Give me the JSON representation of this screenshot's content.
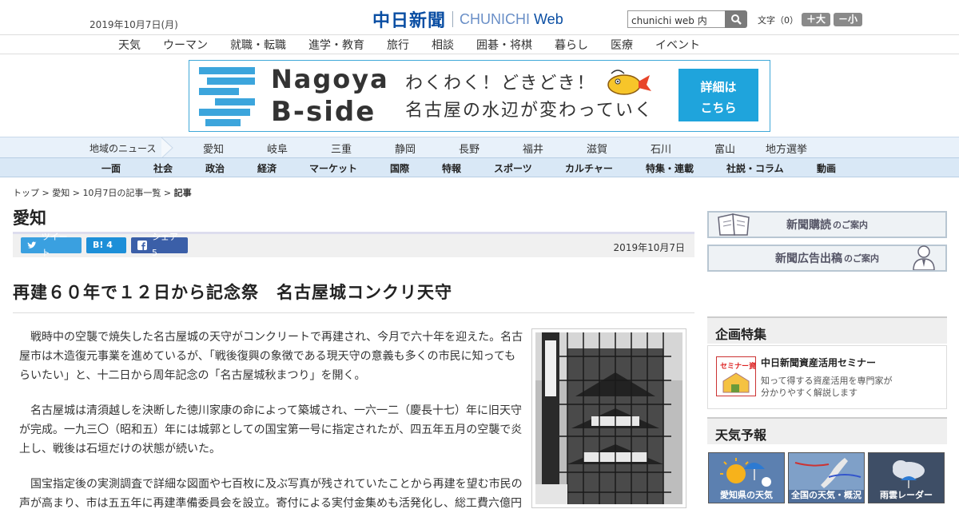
{
  "header": {
    "date": "2019年10月7日(月)",
    "logo_jp": "中日新聞",
    "logo_en_a": "CHUNICHI ",
    "logo_en_b": "Web",
    "search_value": "chunichi web 内",
    "font_label": "文字（0）",
    "font_large": "＋大",
    "font_small": "－小"
  },
  "catnav": [
    "天気",
    "ウーマン",
    "就職・転職",
    "進学・教育",
    "旅行",
    "相談",
    "囲碁・将棋",
    "暮らし",
    "医療",
    "イベント"
  ],
  "banner": {
    "name1": "Nagoya",
    "name2": "B-side",
    "copy1": "わくわく！どきどき！",
    "copy2": "名古屋の水辺が変わっていく",
    "button1": "詳細は",
    "button2": "こちら"
  },
  "region": {
    "label": "地域のニュース",
    "items": [
      "愛知",
      "岐阜",
      "三重",
      "静岡",
      "長野",
      "福井",
      "滋賀",
      "石川",
      "富山",
      "地方選挙"
    ]
  },
  "genre": [
    "一面",
    "社会",
    "政治",
    "経済",
    "マーケット",
    "国際",
    "特報",
    "スポーツ",
    "カルチャー",
    "特集・連載",
    "社説・コラム",
    "動画"
  ],
  "breadcrumb": {
    "items": [
      "トップ",
      "愛知",
      "10月7日の記事一覧"
    ],
    "sep": " > ",
    "current": "記事"
  },
  "page_title": "愛知",
  "share": {
    "tweet": "ツイート",
    "hatena": "B! 4",
    "facebook": "シェア 5",
    "date": "2019年10月7日"
  },
  "article": {
    "title": "再建６０年で１２日から記念祭　名古屋城コンクリ天守",
    "paragraphs": [
      "戦時中の空襲で焼失した名古屋城の天守がコンクリートで再建され、今月で六十年を迎えた。名古屋市は木造復元事業を進めているが、「戦後復興の象徴である現天守の意義も多くの市民に知ってもらいたい」と、十二日から周年記念の「名古屋城秋まつり」を開く。",
      "名古屋城は清須越しを決断した徳川家康の命によって築城され、一六一二（慶長十七）年に旧天守が完成。一九三〇（昭和五）年には城郭としての国宝第一号に指定されたが、四五年五月の空襲で炎上し、戦後は石垣だけの状態が続いた。",
      "国宝指定後の実測調査で詳細な図面や七百枚に及ぶ写真が残されていたことから再建を望む市民の声が高まり、市は五五年に再建準備委員会を設立。寄付による実付金集めも活発化し、総工費六億円"
    ]
  },
  "sidebar": {
    "subscribe": "新聞購読",
    "subscribe_small": "のご案内",
    "ad": "新聞広告出稿",
    "ad_small": "のご案内",
    "kikaku_title": "企画特集",
    "kikaku_icon": "セミナー資産活用",
    "kikaku_head": "中日新聞資産活用セミナー",
    "kikaku_desc1": "知って得する資産活用を専門家が",
    "kikaku_desc2": "分かりやすく解説します",
    "weather_title": "天気予報",
    "weather": [
      "愛知県の天気",
      "全国の天気・概況",
      "雨雲レーダー"
    ]
  }
}
